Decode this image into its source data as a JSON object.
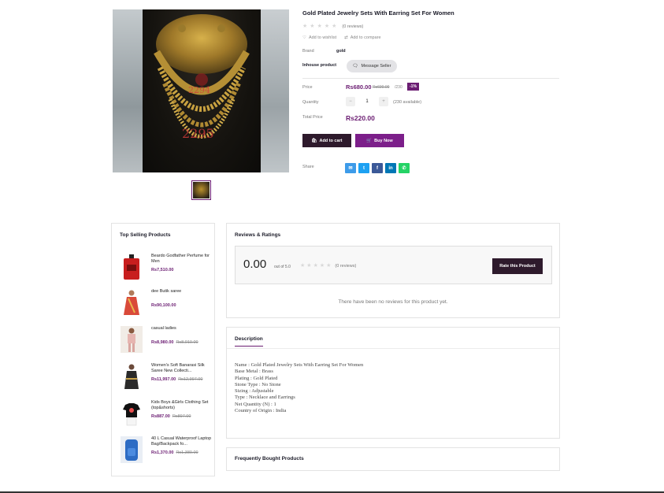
{
  "product": {
    "title": "Gold Plated Jewelry Sets With Earring Set For Women",
    "reviews_count": "(0 reviews)",
    "add_to_wishlist": "Add to wishlist",
    "add_to_compare": "Add to compare",
    "brand_label": "Brand",
    "brand_value": "gold",
    "inhouse_label": "Inhouse product",
    "message_seller": "Message Seller",
    "price_label": "Price",
    "price_now": "Rs680.00",
    "price_old": "Rs690.00",
    "price_unit": "/230",
    "discount": "-1%",
    "quantity_label": "Quantity",
    "quantity_value": "1",
    "qty_minus": "−",
    "qty_plus": "+",
    "available": "(230 available)",
    "total_label": "Total Price",
    "total_value": "Rs220.00",
    "add_to_cart": "Add to cart",
    "buy_now": "Buy Now",
    "share_label": "Share",
    "image_tag_1": "2294",
    "image_tag_2": "2295"
  },
  "share_icons": [
    {
      "name": "email-icon",
      "glyph": "✉",
      "color": "#3d9be9"
    },
    {
      "name": "twitter-icon",
      "glyph": "t",
      "color": "#1da1f2"
    },
    {
      "name": "facebook-icon",
      "glyph": "f",
      "color": "#3b5998"
    },
    {
      "name": "linkedin-icon",
      "glyph": "in",
      "color": "#0077b5"
    },
    {
      "name": "whatsapp-icon",
      "glyph": "✆",
      "color": "#25d366"
    }
  ],
  "sidebar": {
    "title": "Top Selling Products",
    "items": [
      {
        "name": "Beardo Godfather Perfume for Men",
        "price": "Rs7,510.00",
        "old_price": "",
        "img": "perfume"
      },
      {
        "name": "dee Butik saree",
        "price": "Rs90,100.00",
        "old_price": "",
        "img": "saree"
      },
      {
        "name": "casual ladies",
        "price": "Rs8,980.00",
        "old_price": "Rs8,010.00",
        "img": "ladies"
      },
      {
        "name": "Women's Soft Banarasi Silk Saree New Collecti...",
        "price": "Rs11,997.00",
        "old_price": "Rs12,997.00",
        "img": "banarasi"
      },
      {
        "name": "Kids Boys &Girls Clothing Set (top&shorts)",
        "price": "Rs887.00",
        "old_price": "Rs897.00",
        "img": "kids"
      },
      {
        "name": "40 L Casual Waterproof Laptop Bag/Backpack fo...",
        "price": "Rs1,370.00",
        "old_price": "Rs1,380.00",
        "img": "backpack"
      }
    ]
  },
  "reviews": {
    "title": "Reviews & Ratings",
    "rating": "0.00",
    "out_of": "out of 5.0",
    "count": "(0 reviews)",
    "rate_button": "Rate this Product",
    "empty_message": "There have been no reviews for this product yet."
  },
  "description": {
    "tab": "Description",
    "lines": [
      "Name : Gold Plated Jewelry Sets With Earring Set For Women",
      "Base Metal : Brass",
      "Plating : Gold Plated",
      "Stone Type : No Stone",
      "Sizing : Adjustable",
      "Type : Necklace and Earrings",
      "Net Quantity (N) : 1",
      "Country of Origin : India"
    ]
  },
  "frequently_bought": {
    "title": "Frequently Bought Products"
  }
}
